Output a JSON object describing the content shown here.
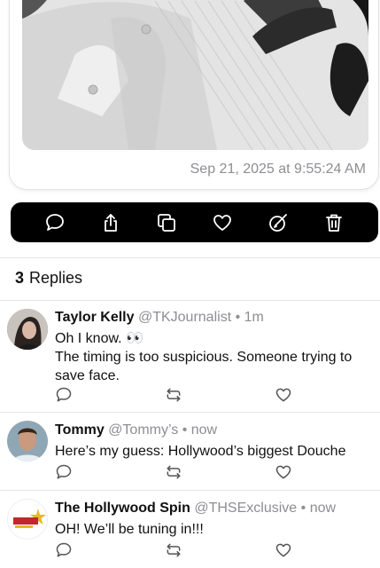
{
  "post": {
    "timestamp": "Sep 21, 2025 at 9:55:24 AM"
  },
  "action_bar": {
    "icons": [
      "comment-icon",
      "share-icon",
      "copy-icon",
      "heart-icon",
      "edit-icon",
      "trash-icon"
    ]
  },
  "replies_header": {
    "count": "3",
    "label": "Replies"
  },
  "replies": [
    {
      "name": "Taylor Kelly",
      "handle": "@TKJournalist",
      "time": "1m",
      "text_line1": "Oh I know. 👀",
      "text_line2": "The timing is too suspicious. Someone trying to save face."
    },
    {
      "name": "Tommy",
      "handle": "@Tommy’s",
      "time": "now",
      "text_line1": "Here’s my guess: Hollywood’s biggest Douche"
    },
    {
      "name": "The Hollywood Spin",
      "handle": "@THSExclusive",
      "time": "now",
      "text_line1": "OH! We’ll be tuning in!!!"
    }
  ],
  "separator": "•",
  "colors": {
    "accent_text": "#111111",
    "muted": "#8e8e93",
    "bar": "#000000"
  }
}
